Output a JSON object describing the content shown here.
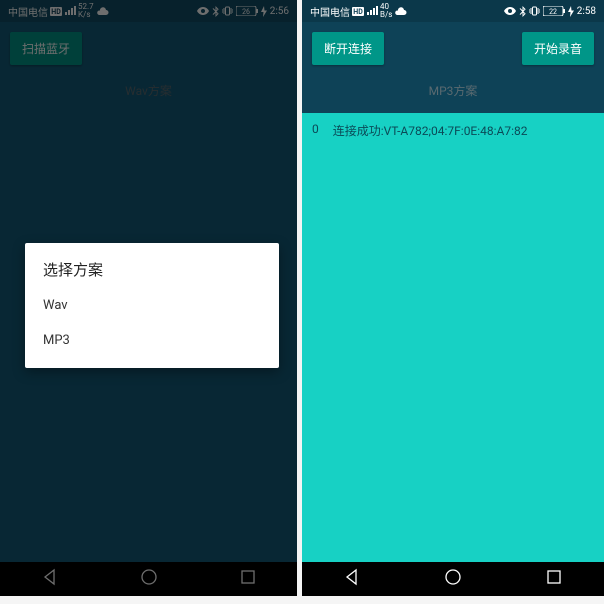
{
  "left": {
    "status": {
      "carrier": "中国电信",
      "net": "52.7",
      "net_unit": "K/s",
      "time": "2:56"
    },
    "buttons": {
      "scan": "扫描蓝牙"
    },
    "scheme_label": "Wav方案",
    "dialog": {
      "title": "选择方案",
      "items": [
        "Wav",
        "MP3"
      ]
    }
  },
  "right": {
    "status": {
      "carrier": "中国电信",
      "net": "40",
      "net_unit": "B/s",
      "time": "2:58"
    },
    "buttons": {
      "disconnect": "断开连接",
      "record": "开始录音"
    },
    "scheme_label": "MP3方案",
    "log": {
      "index": "0",
      "text": "连接成功:VT-A782;04:7F:0E:48:A7:82"
    }
  }
}
